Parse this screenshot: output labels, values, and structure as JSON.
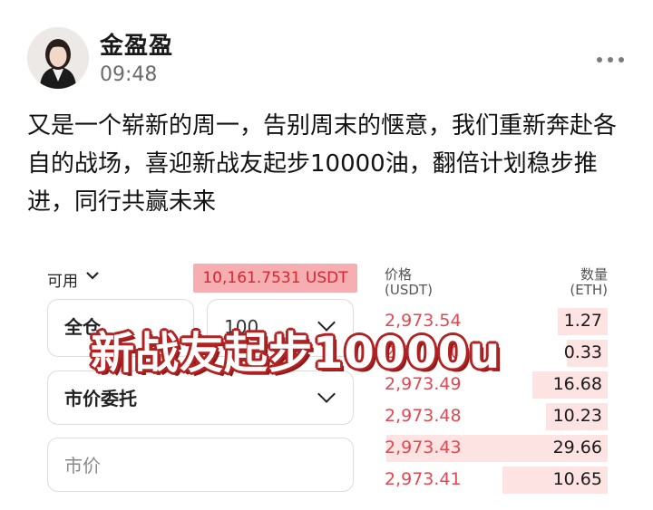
{
  "header": {
    "author_name": "金盈盈",
    "post_time": "09:48"
  },
  "post": {
    "text": "又是一个崭新的周一，告别周末的惬意，我们重新奔赴各自的战场，喜迎新战友起步10000油，翻倍计划稳步推进，同行共赢未来"
  },
  "trade_panel": {
    "available_label": "可用",
    "balance": "10,161.7531 USDT",
    "all_label": "全仓",
    "amount_value": "100",
    "order_type": "市价委托",
    "price_placeholder": "市价"
  },
  "order_book": {
    "price_header_line1": "价格",
    "price_header_line2": "(USDT)",
    "qty_header_line1": "数量",
    "qty_header_line2": "(ETH)",
    "rows": [
      {
        "price": "2,973.54",
        "qty": "1.27",
        "depth": 0.22
      },
      {
        "price": "2,973.50",
        "qty": "0.33",
        "depth": 0.18
      },
      {
        "price": "2,973.49",
        "qty": "16.68",
        "depth": 0.33
      },
      {
        "price": "2,973.48",
        "qty": "10.23",
        "depth": 0.27
      },
      {
        "price": "2,973.43",
        "qty": "29.66",
        "depth": 0.97
      },
      {
        "price": "2,973.41",
        "qty": "10.65",
        "depth": 0.46
      }
    ]
  },
  "overlay": {
    "banner_text": "新战友起步10000u"
  },
  "colors": {
    "sell_price": "#e2484f",
    "balance_highlight": "#f7aeb0",
    "depth_bar": "#fde3e2",
    "banner_outline": "#b22222"
  },
  "icons": {
    "more": "more-dots-icon",
    "transfer": "swap-arrows-icon",
    "dropdown": "chevron-down-icon"
  }
}
